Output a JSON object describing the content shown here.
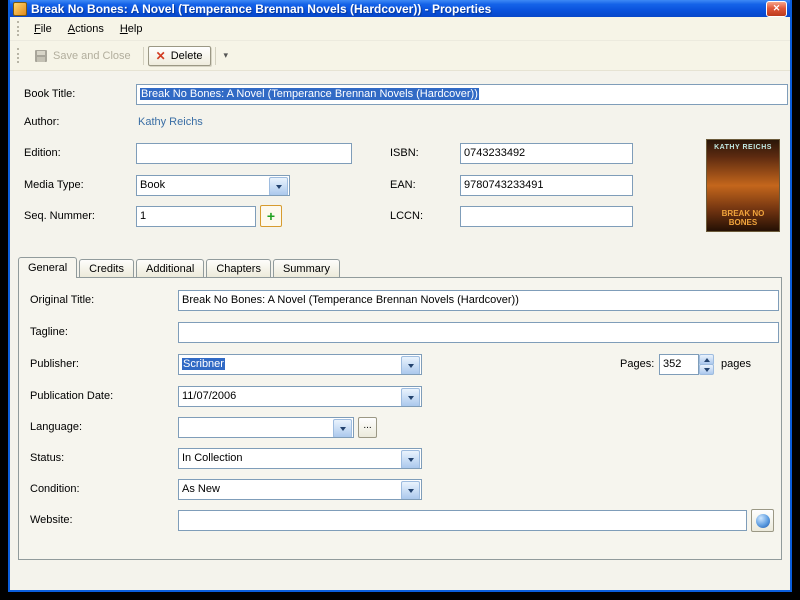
{
  "window": {
    "title": "Break No Bones: A Novel (Temperance Brennan Novels (Hardcover)) - Properties"
  },
  "icons": {
    "close": "✕",
    "delete": "✕",
    "overflow": "▾",
    "plus": "+"
  },
  "menu": {
    "items": [
      {
        "label": "File"
      },
      {
        "label": "Actions"
      },
      {
        "label": "Help"
      }
    ]
  },
  "toolbar": {
    "save_label": "Save and Close",
    "delete_label": "Delete"
  },
  "form": {
    "book_title": {
      "label": "Book Title:",
      "value": "Break No Bones: A Novel (Temperance Brennan Novels (Hardcover))"
    },
    "author": {
      "label": "Author:",
      "value": "Kathy Reichs"
    },
    "edition": {
      "label": "Edition:",
      "value": ""
    },
    "media_type": {
      "label": "Media Type:",
      "value": "Book"
    },
    "seq_number": {
      "label": "Seq. Nummer:",
      "value": "1"
    },
    "isbn": {
      "label": "ISBN:",
      "value": "0743233492"
    },
    "ean": {
      "label": "EAN:",
      "value": "9780743233491"
    },
    "lccn": {
      "label": "LCCN:",
      "value": ""
    }
  },
  "cover": {
    "author_text": "KATHY REICHS",
    "title_text": "BREAK NO BONES"
  },
  "tabs": [
    {
      "label": "General",
      "active": true
    },
    {
      "label": "Credits",
      "active": false
    },
    {
      "label": "Additional",
      "active": false
    },
    {
      "label": "Chapters",
      "active": false
    },
    {
      "label": "Summary",
      "active": false
    }
  ],
  "general": {
    "original_title": {
      "label": "Original Title:",
      "value": "Break No Bones: A Novel (Temperance Brennan Novels (Hardcover))"
    },
    "tagline": {
      "label": "Tagline:",
      "value": ""
    },
    "publisher": {
      "label": "Publisher:",
      "value": "Scribner"
    },
    "pages": {
      "label": "Pages:",
      "value": "352",
      "suffix": "pages"
    },
    "publication_date": {
      "label": "Publication Date:",
      "value": "11/07/2006"
    },
    "language": {
      "label": "Language:",
      "value": "",
      "browse_label": "..."
    },
    "status": {
      "label": "Status:",
      "value": "In Collection"
    },
    "condition": {
      "label": "Condition:",
      "value": "As New"
    },
    "website": {
      "label": "Website:",
      "value": ""
    }
  },
  "colors": {
    "selection": "#316ac5",
    "titlebar": "#0a52dd",
    "link": "#3a6ea5"
  }
}
